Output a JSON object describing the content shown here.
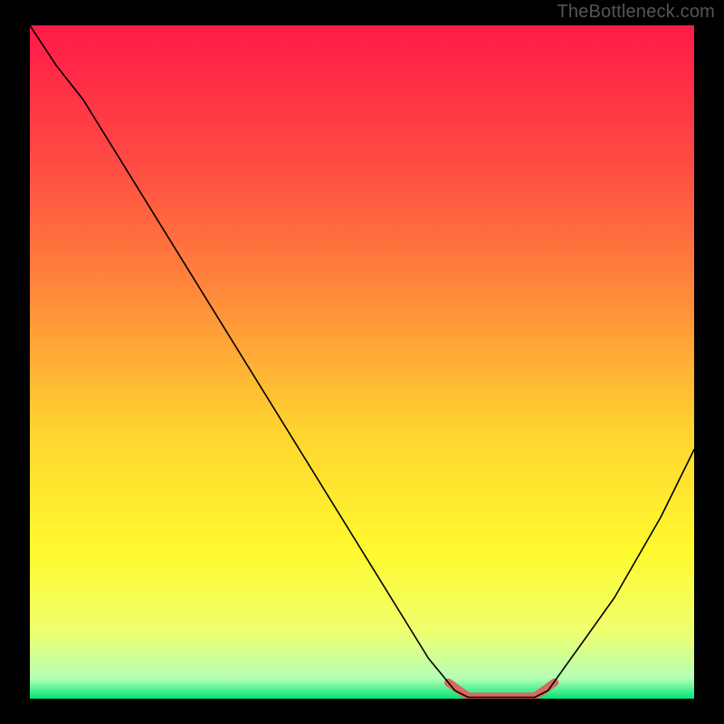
{
  "watermark": "TheBottleneck.com",
  "chart_data": {
    "type": "line",
    "title": "",
    "xlabel": "",
    "ylabel": "",
    "xlim": [
      0,
      100
    ],
    "ylim": [
      0,
      100
    ],
    "legend": false,
    "grid": false,
    "background": {
      "type": "vertical-gradient",
      "stops": [
        {
          "offset": 0.0,
          "color": "#ff1a48"
        },
        {
          "offset": 0.2,
          "color": "#ff4a44"
        },
        {
          "offset": 0.4,
          "color": "#ff8a3a"
        },
        {
          "offset": 0.6,
          "color": "#ffd330"
        },
        {
          "offset": 0.78,
          "color": "#fff92e"
        },
        {
          "offset": 0.9,
          "color": "#efff6f"
        },
        {
          "offset": 0.97,
          "color": "#b5ffb5"
        },
        {
          "offset": 1.0,
          "color": "#00e676"
        }
      ]
    },
    "series": [
      {
        "name": "bottleneck-curve",
        "color": "#000000",
        "width": 1.6,
        "points": [
          {
            "x": 0,
            "y": 100
          },
          {
            "x": 4,
            "y": 94
          },
          {
            "x": 8,
            "y": 89
          },
          {
            "x": 60,
            "y": 6
          },
          {
            "x": 64,
            "y": 1.2
          },
          {
            "x": 66,
            "y": 0.2
          },
          {
            "x": 76,
            "y": 0.2
          },
          {
            "x": 78,
            "y": 1.2
          },
          {
            "x": 88,
            "y": 15
          },
          {
            "x": 95,
            "y": 27
          },
          {
            "x": 100,
            "y": 37
          }
        ]
      }
    ],
    "highlight": {
      "name": "optimal-range",
      "color": "#d86a62",
      "width": 9,
      "points": [
        {
          "x": 63,
          "y": 2.4
        },
        {
          "x": 66,
          "y": 0.3
        },
        {
          "x": 76,
          "y": 0.3
        },
        {
          "x": 79,
          "y": 2.4
        }
      ]
    }
  }
}
